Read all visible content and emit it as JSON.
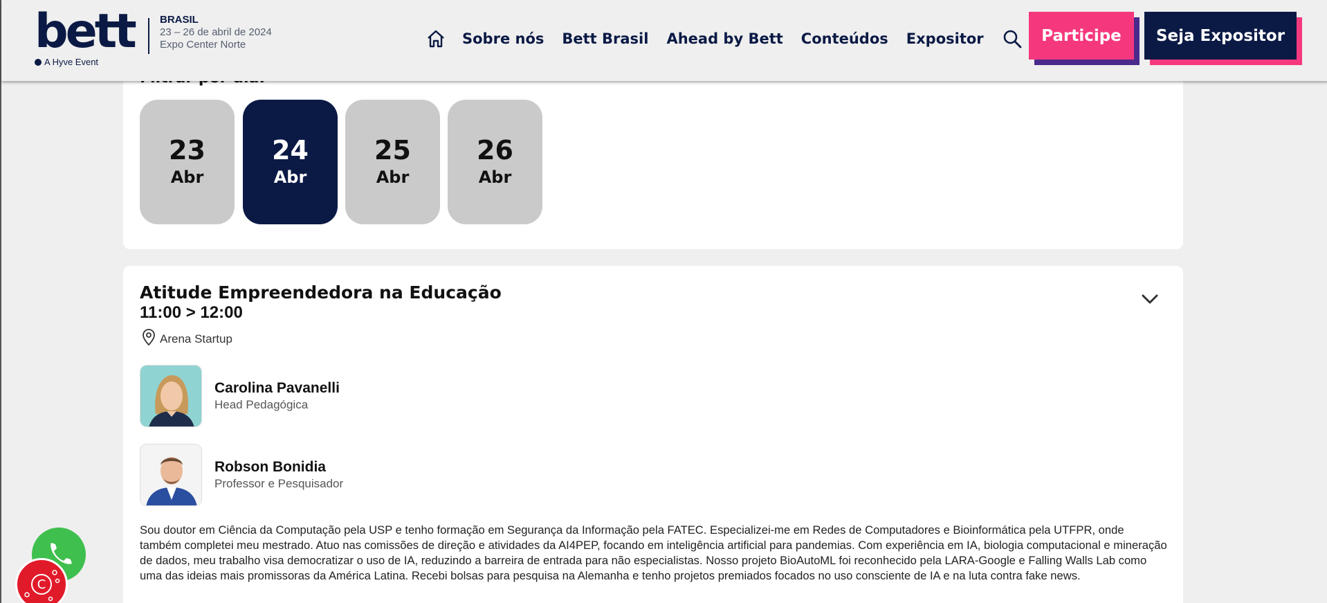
{
  "header": {
    "logo_text": "bett",
    "logo_country": "BRASIL",
    "logo_dates": "23 – 26 de abril de 2024",
    "logo_venue": "Expo Center Norte",
    "logo_tagline": "A Hyve Event",
    "nav": [
      "Sobre nós",
      "Bett Brasil",
      "Ahead by Bett",
      "Conteúdos",
      "Expositor"
    ],
    "btn_participe": "Participe",
    "btn_expositor": "Seja Expositor"
  },
  "filter": {
    "title": "Filtrar por dia:",
    "days": [
      {
        "num": "23",
        "mon": "Abr"
      },
      {
        "num": "24",
        "mon": "Abr"
      },
      {
        "num": "25",
        "mon": "Abr"
      },
      {
        "num": "26",
        "mon": "Abr"
      }
    ],
    "selected": "24"
  },
  "session": {
    "title": "Atitude Empreendedora na Educação",
    "time": "11:00 > 12:00",
    "location": "Arena Startup",
    "speakers": [
      {
        "name": "Carolina Pavanelli",
        "role": "Head Pedagógica"
      },
      {
        "name": "Robson Bonidia",
        "role": "Professor e Pesquisador"
      }
    ],
    "bio": "Sou doutor em Ciência da Computação pela USP e tenho formação em Segurança da Informação pela FATEC. Especializei-me em Redes de Computadores e Bioinformática pela UTFPR, onde também completei meu mestrado. Atuo nas comissões de direção e atividades da AI4PEP, focando em inteligência artificial para pandemias. Com experiência em IA, biologia computacional e mineração de dados, meu trabalho visa democratizar o uso de IA, reduzindo a barreira de entrada para não especialistas. Nosso projeto BioAutoML foi reconhecido pela LARA-Google e Falling Walls Lab como uma das ideias mais promissoras da América Latina. Recebi bolsas para pesquisa na Alemanha e tenho projetos premiados focados no uso consciente de IA e na luta contra fake news."
  },
  "colors": {
    "navy": "#0b1a45",
    "pink": "#f5387e",
    "purple": "#4a2a8c",
    "day_inactive": "#cacaca"
  }
}
